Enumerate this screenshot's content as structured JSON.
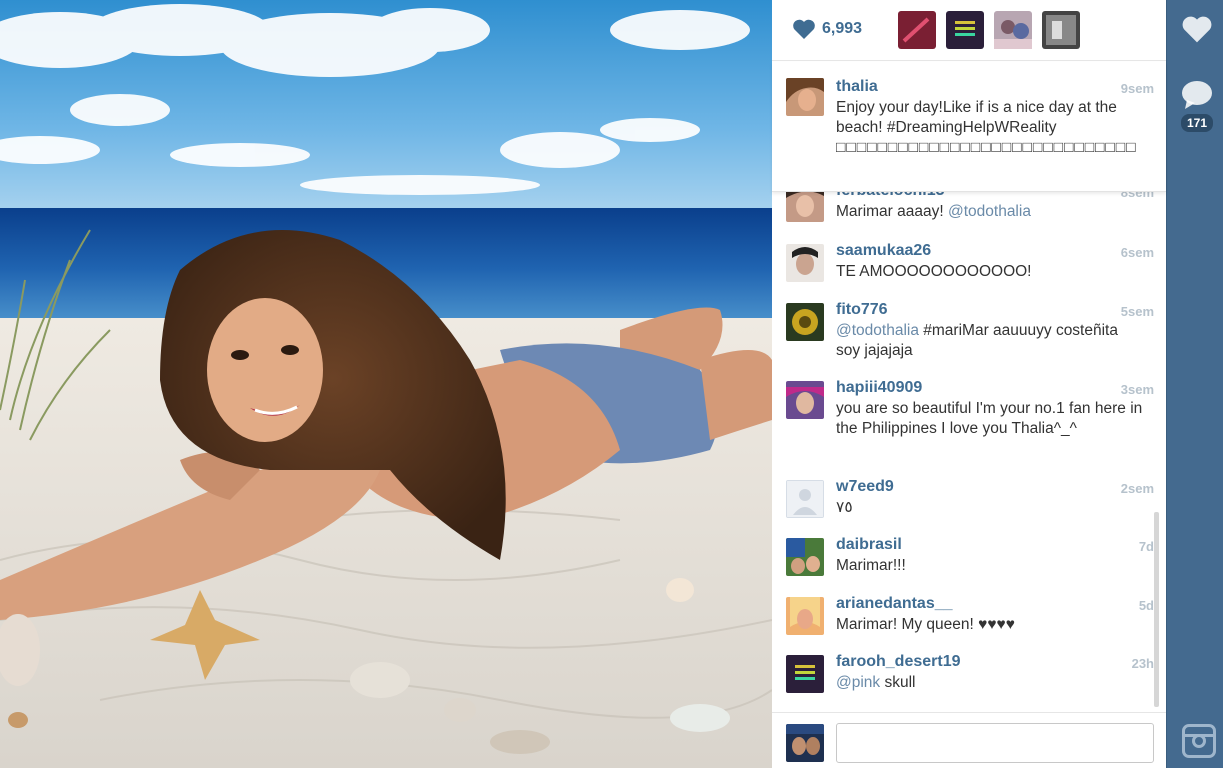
{
  "photo": {
    "alt": ""
  },
  "likes": {
    "count": "6,993",
    "color": "#3f6c92"
  },
  "likers": [
    {
      "name": "liker-1",
      "color": "#7a1f33"
    },
    {
      "name": "liker-2",
      "color": "#2b1f3a"
    },
    {
      "name": "liker-3",
      "color": "#8e6c7a"
    },
    {
      "name": "liker-4",
      "color": "#555555"
    }
  ],
  "caption": {
    "username": "thalia",
    "time": "9sem",
    "text": "Enjoy your day!Like if is a nice day at the beach! #DreamingHelpWReality",
    "glyphs": "□□□□□□□□□□□□□□□□□□□□□□□□□□□□□"
  },
  "comments": [
    {
      "username": "ferbatelochi13",
      "time": "8sem",
      "text": "Marimar aaaay! ",
      "mention": "@todothalia",
      "avatar": "#c49a86"
    },
    {
      "username": "saamukaa26",
      "time": "6sem",
      "text": "TE AMOOOOOOOOOOOO!",
      "mention": "",
      "avatar": "#b59a8c"
    },
    {
      "username": "fito776",
      "time": "5sem",
      "text": " #mariMar aauuuyy costeñita soy jajajaja",
      "mention": "@todothalia",
      "avatar": "#a89020"
    },
    {
      "username": "hapiii40909",
      "time": "3sem",
      "text": "you are so beautiful I'm your no.1 fan here in the Philippines I love you Thalia^_^",
      "mention": "",
      "avatar": "#8a6aa0"
    },
    {
      "username": "w7eed9",
      "time": "2sem",
      "text": "٧٥",
      "mention": "",
      "avatar": "#e8ecf2"
    },
    {
      "username": "daibrasil",
      "time": "7d",
      "text": "Marimar!!!",
      "mention": "",
      "avatar": "#4a7a3a"
    },
    {
      "username": "arianedantas__",
      "time": "5d",
      "text": "Marimar! My queen! ♥♥♥♥",
      "mention": "",
      "avatar": "#e0a070"
    },
    {
      "username": "farooh_desert19",
      "time": "23h",
      "text": " skull",
      "mention": "@pink",
      "avatar": "#2b1f3a"
    }
  ],
  "composer": {
    "placeholder": "",
    "avatar": "#1e3050"
  },
  "rail": {
    "like_icon": "heart-icon",
    "comment_icon": "speech-bubble-icon",
    "comment_count": "171",
    "logo": "instagram-camera-icon",
    "color": "#446a8f"
  }
}
